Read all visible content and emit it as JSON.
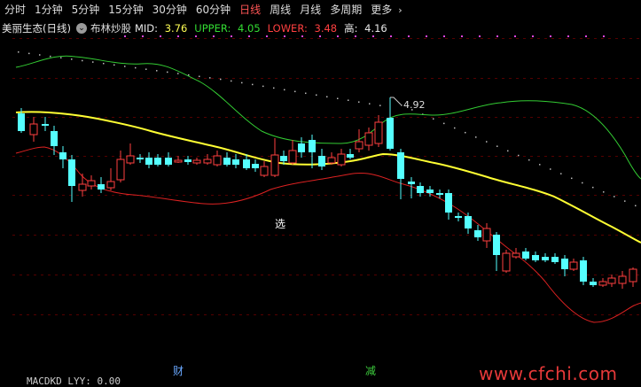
{
  "toolbar": {
    "tabs": [
      {
        "label": "分时",
        "active": false
      },
      {
        "label": "1分钟",
        "active": false
      },
      {
        "label": "5分钟",
        "active": false
      },
      {
        "label": "15分钟",
        "active": false
      },
      {
        "label": "30分钟",
        "active": false
      },
      {
        "label": "60分钟",
        "active": false
      },
      {
        "label": "日线",
        "active": true
      },
      {
        "label": "周线",
        "active": false
      },
      {
        "label": "月线",
        "active": false
      },
      {
        "label": "多周期",
        "active": false
      },
      {
        "label": "更多",
        "active": false
      }
    ],
    "more_arrow": "›"
  },
  "info": {
    "stock_name": "美丽生态(日线)",
    "toggle_icon": "chevron-down-circle-icon",
    "indicator_name": "布林炒股",
    "mid_label": "MID:",
    "mid_value": "3.76",
    "upper_label": "UPPER:",
    "upper_value": "4.05",
    "lower_label": "LOWER:",
    "lower_value": "3.48",
    "high_label": "高:",
    "high_value": "4.16"
  },
  "annotations": {
    "peak_price": "4.92",
    "select_marker": "选",
    "event_cai": "财",
    "event_jian": "减"
  },
  "bottom_label": "MACDKD LYY: 0.00",
  "watermark": "www.cfchi.com",
  "colors": {
    "background": "#000000",
    "up_candle": "#ff4040",
    "down_candle": "#55ffff",
    "mid_line": "#ffff33",
    "upper_line": "#33cc33",
    "lower_line": "#dd2222",
    "active_tab": "#ff5555"
  }
}
